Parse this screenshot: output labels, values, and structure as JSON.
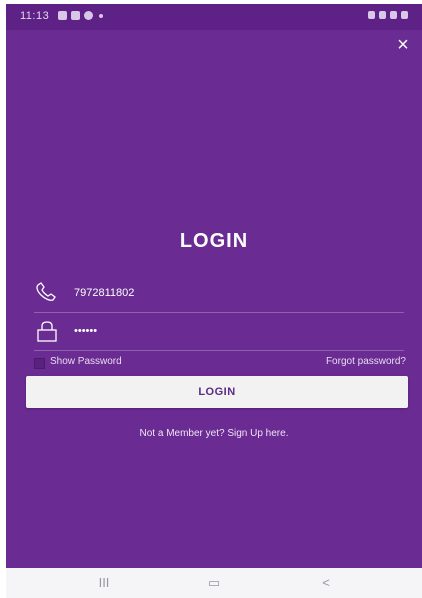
{
  "status_bar": {
    "time": "11:13",
    "left_icons": [
      "gallery-icon",
      "message-icon",
      "chat-icon",
      "dot-icon"
    ],
    "right_icons": [
      "mute-icon",
      "wifi-icon",
      "signal-icon",
      "battery-icon"
    ]
  },
  "colors": {
    "background": "#6a2b93",
    "status_bar": "#5e2286",
    "button_bg": "#f2f2f2",
    "button_text": "#5b2a86",
    "nav_bar": "#f5f4f6"
  },
  "header": {
    "close_icon": "close-icon",
    "close_glyph": "×"
  },
  "login": {
    "title": "LOGIN",
    "phone": {
      "icon": "phone-icon",
      "value": "7972811802"
    },
    "password": {
      "icon": "lock-icon",
      "value": "••••••"
    },
    "show_password_label": "Show Password",
    "forgot_password_label": "Forgot password?",
    "login_button_label": "LOGIN",
    "signup_text": "Not a Member yet? Sign Up here."
  },
  "nav_bar": {
    "recent_glyph": "III",
    "home_glyph": "▭",
    "back_glyph": "<"
  }
}
